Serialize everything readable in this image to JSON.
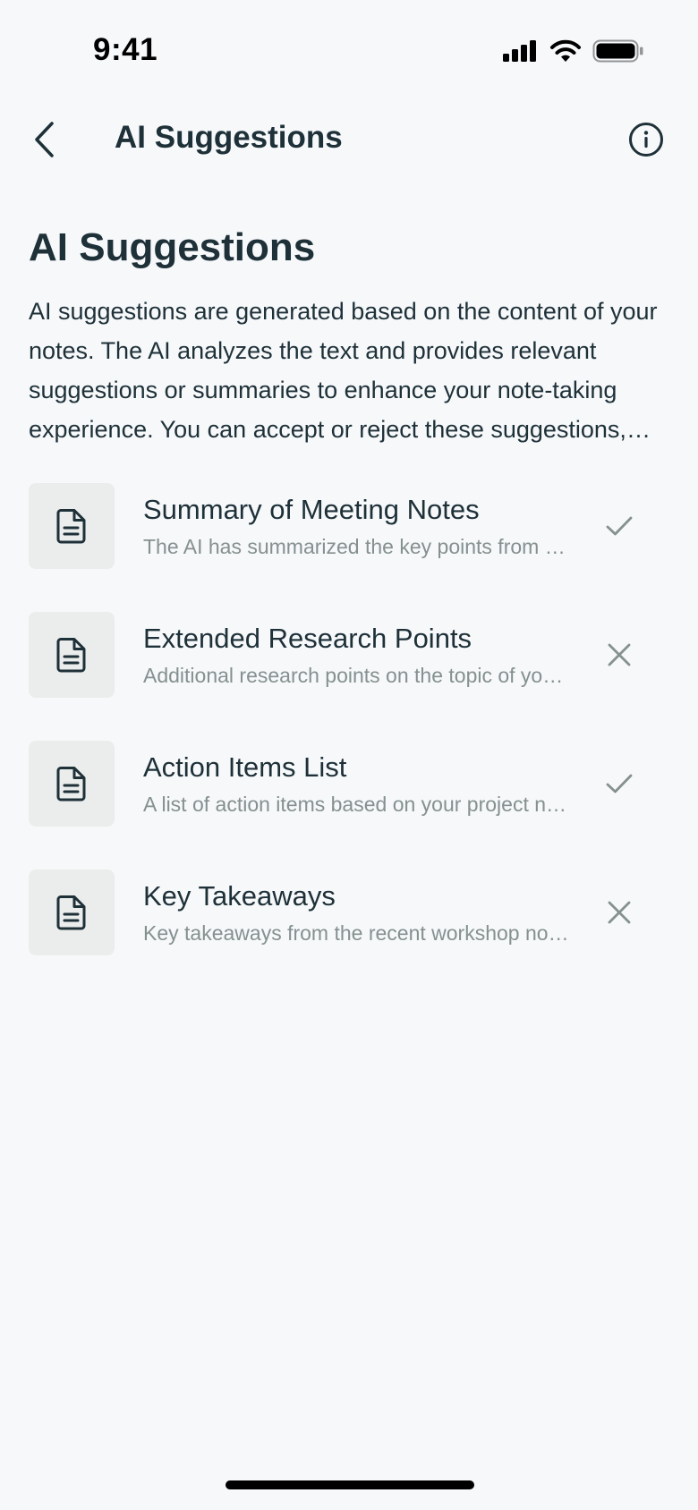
{
  "status_bar": {
    "time": "9:41"
  },
  "nav": {
    "title": "AI Suggestions"
  },
  "content": {
    "heading": "AI Suggestions",
    "description": "AI suggestions are generated based on the content of your notes. The AI analyzes the text and provides relevant suggestions or summaries to enhance your note-taking experience. You can accept or reject these suggestions, allowing you to maintain control over your notes."
  },
  "suggestions": [
    {
      "title": "Summary of Meeting Notes",
      "subtitle": "The AI has summarized the key points from your recent meeting notes.",
      "status": "accepted",
      "icon": "document-icon"
    },
    {
      "title": "Extended Research Points",
      "subtitle": "Additional research points on the topic of your notes have been generated.",
      "status": "rejected",
      "icon": "document-icon"
    },
    {
      "title": "Action Items List",
      "subtitle": "A list of action items based on your project notes has been created.",
      "status": "accepted",
      "icon": "document-icon"
    },
    {
      "title": "Key Takeaways",
      "subtitle": "Key takeaways from the recent workshop notes are ready.",
      "status": "rejected",
      "icon": "document-icon"
    }
  ],
  "colors": {
    "background": "#f6f8fa",
    "text_primary": "#1e3038",
    "text_secondary": "#85908f",
    "thumb_bg": "#ebedec"
  }
}
